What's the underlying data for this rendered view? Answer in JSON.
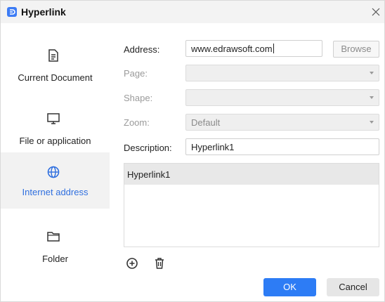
{
  "window": {
    "title": "Hyperlink",
    "app_icon": "edraw-app-icon",
    "close_icon": "close-icon"
  },
  "sidebar": {
    "items": [
      {
        "label": "Current Document",
        "icon": "document-icon",
        "active": false
      },
      {
        "label": "File or application",
        "icon": "monitor-icon",
        "active": false
      },
      {
        "label": "Internet address",
        "icon": "globe-icon",
        "active": true
      },
      {
        "label": "Folder",
        "icon": "folder-icon",
        "active": false
      }
    ]
  },
  "form": {
    "address_label": "Address:",
    "address_value": "www.edrawsoft.com",
    "browse_label": "Browse",
    "page_label": "Page:",
    "page_value": "",
    "shape_label": "Shape:",
    "shape_value": "",
    "zoom_label": "Zoom:",
    "zoom_value": "Default",
    "description_label": "Description:",
    "description_value": "Hyperlink1"
  },
  "list": {
    "items": [
      "Hyperlink1"
    ]
  },
  "toolbar": {
    "add_icon": "add-circle-icon",
    "delete_icon": "trash-icon"
  },
  "buttons": {
    "ok": "OK",
    "cancel": "Cancel"
  },
  "colors": {
    "accent": "#2d7cf5",
    "active_text": "#2f6fdf"
  }
}
